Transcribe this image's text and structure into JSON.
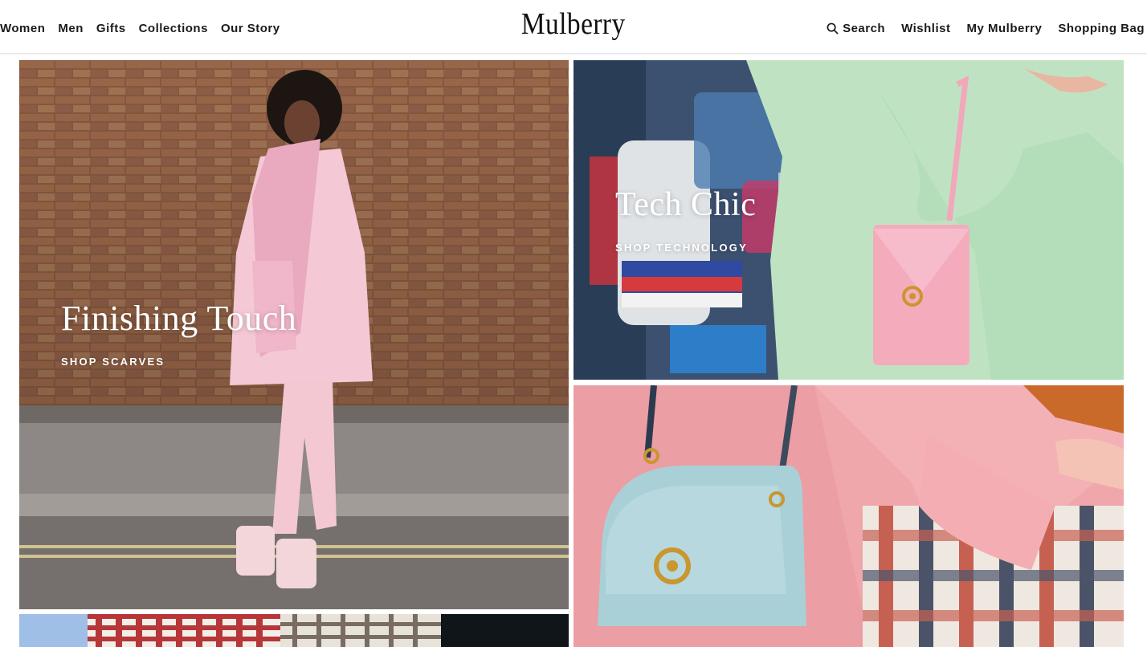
{
  "header": {
    "brand": "Mulberry",
    "nav_left": [
      "Women",
      "Men",
      "Gifts",
      "Collections",
      "Our Story"
    ],
    "nav_right": {
      "search": "Search",
      "wishlist": "Wishlist",
      "account": "My Mulberry",
      "bag": "Shopping Bag"
    }
  },
  "tiles": {
    "scarves": {
      "title": "Finishing Touch",
      "cta": "SHOP SCARVES"
    },
    "technology": {
      "title": "Tech Chic",
      "cta": "SHOP TECHNOLOGY"
    }
  },
  "icons": {
    "search": "search-icon"
  },
  "colors": {
    "brick": "#8a5a3e",
    "coat_pink": "#f2c7d2",
    "mint": "#bfe3c1",
    "bag_pink": "#f3a9ba",
    "bag_blue": "#a9d0d6",
    "coral_coat": "#f1a7a9",
    "gold": "#c8952e"
  }
}
